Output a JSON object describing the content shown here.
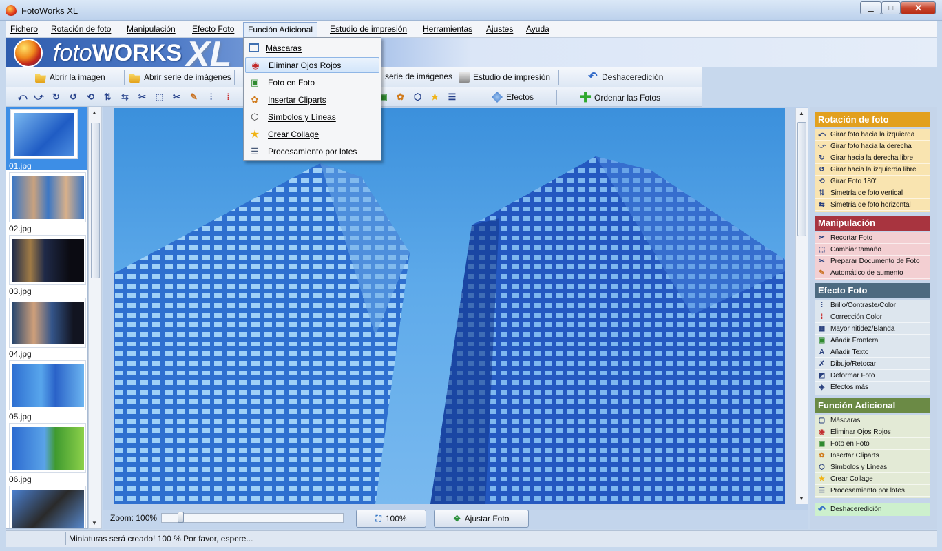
{
  "window": {
    "title": "FotoWorks XL",
    "minimize": "▁",
    "maximize": "□",
    "close": "✕"
  },
  "menu": [
    "Fichero",
    "Rotación de foto",
    "Manipulación",
    "Efecto Foto",
    "Función Adicional",
    "Estudio de impresión",
    "Herramientas",
    "Ajustes",
    "Ayuda"
  ],
  "banner": {
    "prefix": "foto",
    "brand": "WORKS",
    "suffix": "XL"
  },
  "toolbar1": {
    "open_image": "Abrir la imagen",
    "open_series": "Abrir serie de imágenes",
    "save_series": "serie de imágenes",
    "print_studio": "Estudio de impresión",
    "undo": "Deshaceredición"
  },
  "toolbar2": {
    "effects": "Efectos",
    "sort_photos": "Ordenar las Fotos"
  },
  "dropdown": {
    "items": [
      {
        "label": "Máscaras",
        "icon": "mask-icon"
      },
      {
        "label": "Eliminar Ojos Rojos",
        "icon": "red-eye-icon"
      },
      {
        "label": "Foto en Foto",
        "icon": "photo-in-photo-icon"
      },
      {
        "label": "Insertar Cliparts",
        "icon": "clipart-icon"
      },
      {
        "label": "Símbolos y Líneas",
        "icon": "shapes-icon"
      },
      {
        "label": "Crear Collage",
        "icon": "star-icon"
      },
      {
        "label": "Procesamiento por lotes",
        "icon": "batch-icon"
      }
    ]
  },
  "thumbnails": [
    "01.jpg",
    "02.jpg",
    "03.jpg",
    "04.jpg",
    "05.jpg",
    "06.jpg"
  ],
  "zoom": {
    "label": "Zoom: 100%",
    "value_percent": 100,
    "btn_100": "100%",
    "btn_fit": "Ajustar Foto"
  },
  "status": "Miniaturas será creado! 100 %  Por favor, espere...",
  "panel": {
    "rotation": {
      "title": "Rotación de foto",
      "color": "#e2a01e",
      "items": [
        "Girar foto hacia la izquierda",
        "Girar foto hacia la derecha",
        "Girar hacia la derecha libre",
        "Girar hacia la izquierda libre",
        "Girar Foto 180°",
        "Simetría de foto vertical",
        "Simetría de foto horizontal"
      ]
    },
    "manipulation": {
      "title": "Manipulación",
      "color": "#a8343f",
      "items": [
        "Recortar Foto",
        "Cambiar tamaño",
        "Preparar Documento de Foto",
        "Automático de aumento"
      ]
    },
    "effect": {
      "title": "Efecto Foto",
      "color": "#4d6a80",
      "items": [
        "Brillo/Contraste/Color",
        "Corrección Color",
        "Mayor nitidez/Blanda",
        "Añadir Frontera",
        "Añadir Texto",
        "Dibujo/Retocar",
        "Deformar Foto",
        "Efectos más"
      ]
    },
    "additional": {
      "title": "Función Adicional",
      "color": "#6b8a45",
      "items": [
        "Máscaras",
        "Eliminar Ojos Rojos",
        "Foto en Foto",
        "Insertar Cliparts",
        "Símbolos y Líneas",
        "Crear Collage",
        "Procesamiento por lotes"
      ]
    },
    "undo": "Deshaceredición"
  }
}
